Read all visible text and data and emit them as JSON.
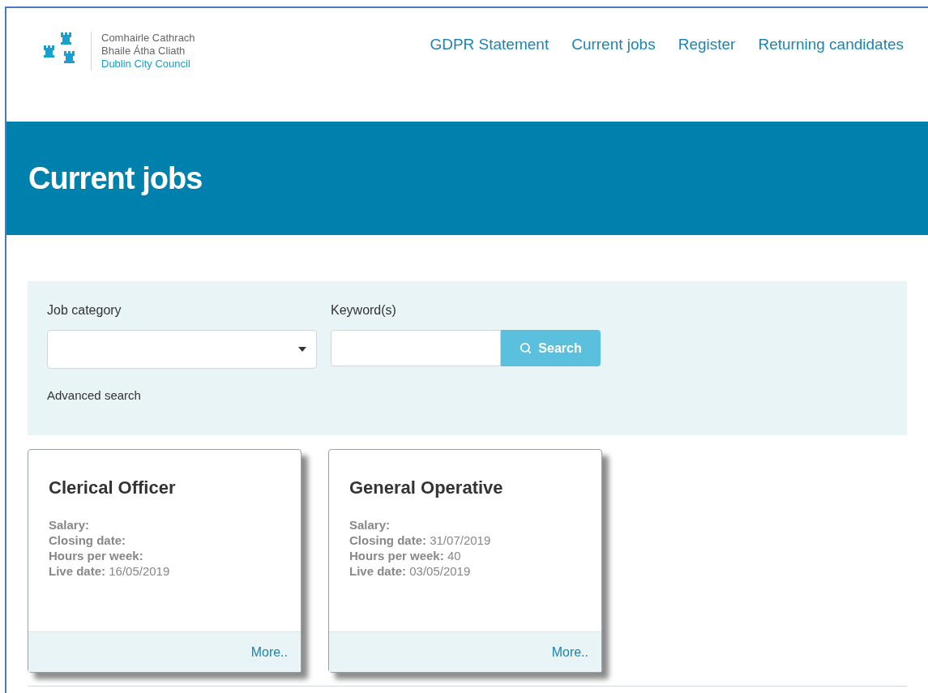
{
  "logo": {
    "line_1": "Comhairle Cathrach",
    "line_2": "Bhaile Átha Cliath",
    "line_3": "Dublin City Council"
  },
  "nav": [
    "GDPR Statement",
    "Current jobs",
    "Register",
    "Returning candidates"
  ],
  "banner": {
    "title": "Current jobs"
  },
  "search": {
    "category_label": "Job category",
    "keyword_label": "Keyword(s)",
    "button": "Search",
    "advanced": "Advanced search"
  },
  "jobs": [
    {
      "title": "Clerical Officer",
      "fields": [
        "**Salary:**",
        "**Closing date:**",
        "**Hours per week:**",
        "**Live date:** 16/05/2019"
      ],
      "more": "More.."
    },
    {
      "title": "General Operative",
      "fields": [
        "**Salary:**",
        "**Closing date:** 31/07/2019",
        "**Hours per week:** 40",
        "**Live date:** 03/05/2019"
      ],
      "more": "More.."
    }
  ]
}
